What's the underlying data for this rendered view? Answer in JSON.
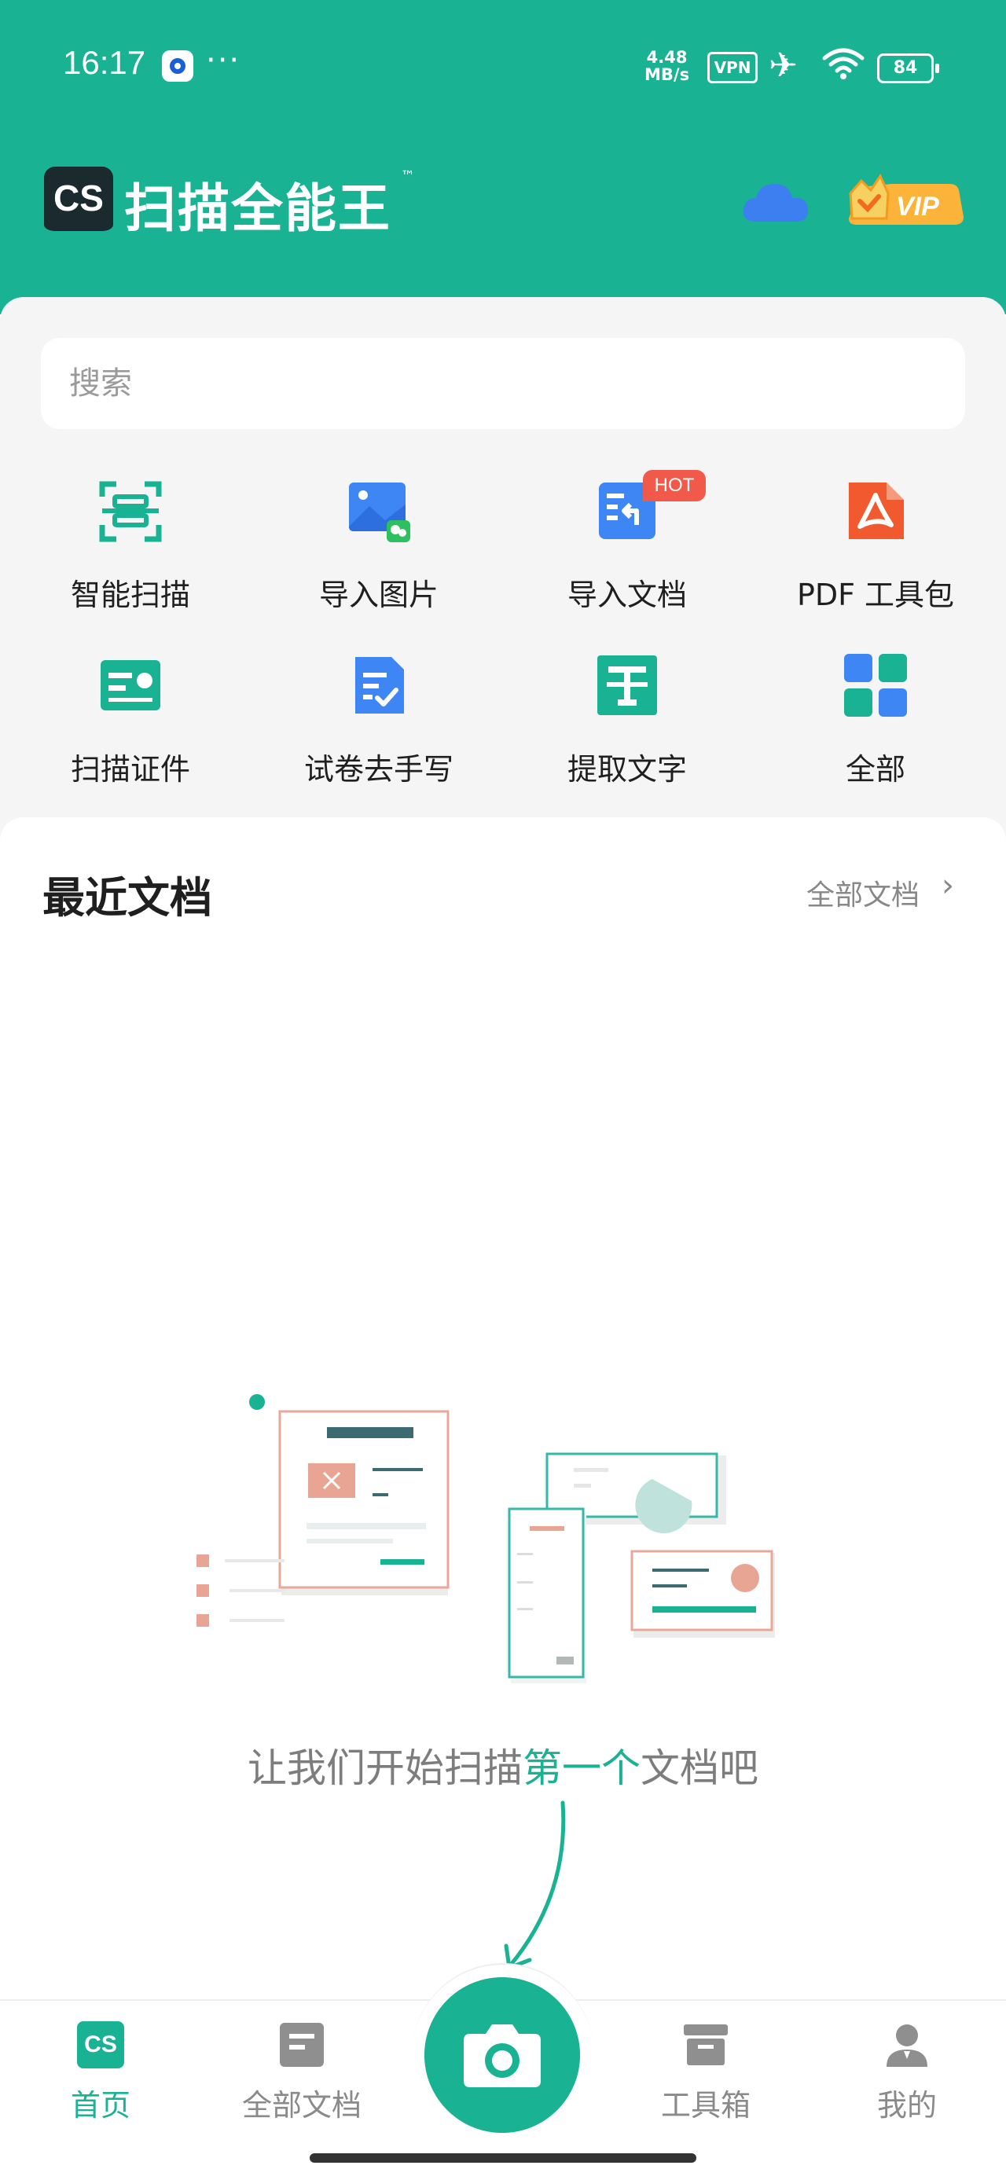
{
  "status_bar": {
    "time": "16:17",
    "more": "···",
    "net_speed_value": "4.48",
    "net_speed_unit": "MB/s",
    "vpn": "VPN",
    "battery": "84"
  },
  "header": {
    "logo_text": "CS",
    "app_name": "扫描全能王",
    "trademark": "™",
    "vip_label": "VIP"
  },
  "search": {
    "placeholder": "搜索"
  },
  "tools": [
    {
      "label": "智能扫描",
      "icon": "smart-scan-icon"
    },
    {
      "label": "导入图片",
      "icon": "import-image-icon"
    },
    {
      "label": "导入文档",
      "icon": "import-document-icon",
      "badge": "HOT"
    },
    {
      "label": "PDF 工具包",
      "icon": "pdf-toolkit-icon"
    },
    {
      "label": "扫描证件",
      "icon": "scan-id-icon"
    },
    {
      "label": "试卷去手写",
      "icon": "remove-handwriting-icon"
    },
    {
      "label": "提取文字",
      "icon": "extract-text-icon"
    },
    {
      "label": "全部",
      "icon": "all-tools-icon"
    }
  ],
  "recent": {
    "title": "最近文档",
    "all_docs_link": "全部文档",
    "empty_message_pre": "让我们开始扫描",
    "empty_message_highlight": "第一个",
    "empty_message_post": "文档吧"
  },
  "bottom_nav": {
    "home": "首页",
    "home_icon_text": "CS",
    "all_docs": "全部文档",
    "toolbox": "工具箱",
    "mine": "我的"
  },
  "colors": {
    "brand": "#19b293",
    "hot": "#f15a4a",
    "cloud": "#3d7ef0"
  }
}
